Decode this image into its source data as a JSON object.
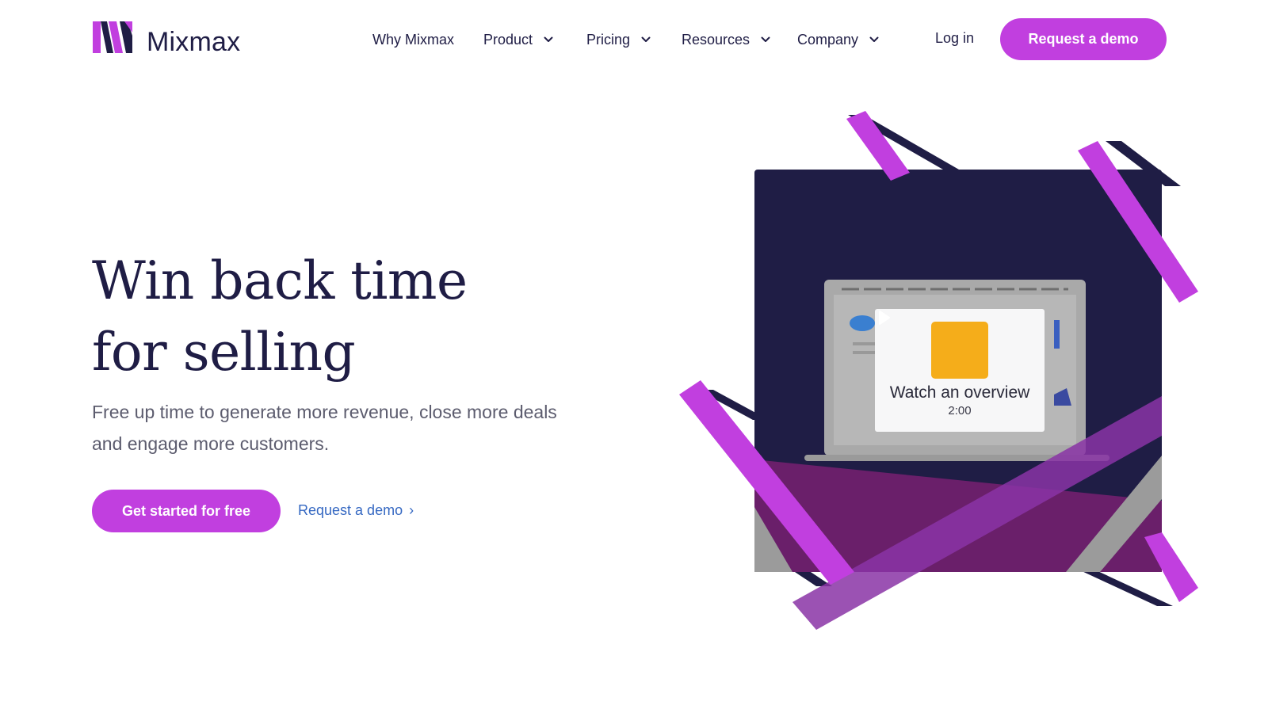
{
  "brand": {
    "name": "Mixmax",
    "accent": "#c13fdf",
    "navy": "#1f1d45"
  },
  "nav": {
    "items": [
      {
        "label": "Why Mixmax",
        "has_dropdown": false
      },
      {
        "label": "Product",
        "has_dropdown": true
      },
      {
        "label": "Pricing",
        "has_dropdown": true
      },
      {
        "label": "Resources",
        "has_dropdown": true
      },
      {
        "label": "Company",
        "has_dropdown": true
      }
    ],
    "login_label": "Log in",
    "cta_label": "Request a demo"
  },
  "hero": {
    "headline_line1": "Win back time",
    "headline_line2": "for selling",
    "subtext": "Free up time to generate more revenue, close more deals and engage more customers.",
    "primary_cta": "Get started for free",
    "secondary_cta": "Request a demo",
    "secondary_cta_icon": "chevron-right-icon"
  },
  "video": {
    "title": "Watch an overview",
    "duration": "2:00",
    "icon": "play-icon",
    "play_color": "#f5ad1a"
  }
}
